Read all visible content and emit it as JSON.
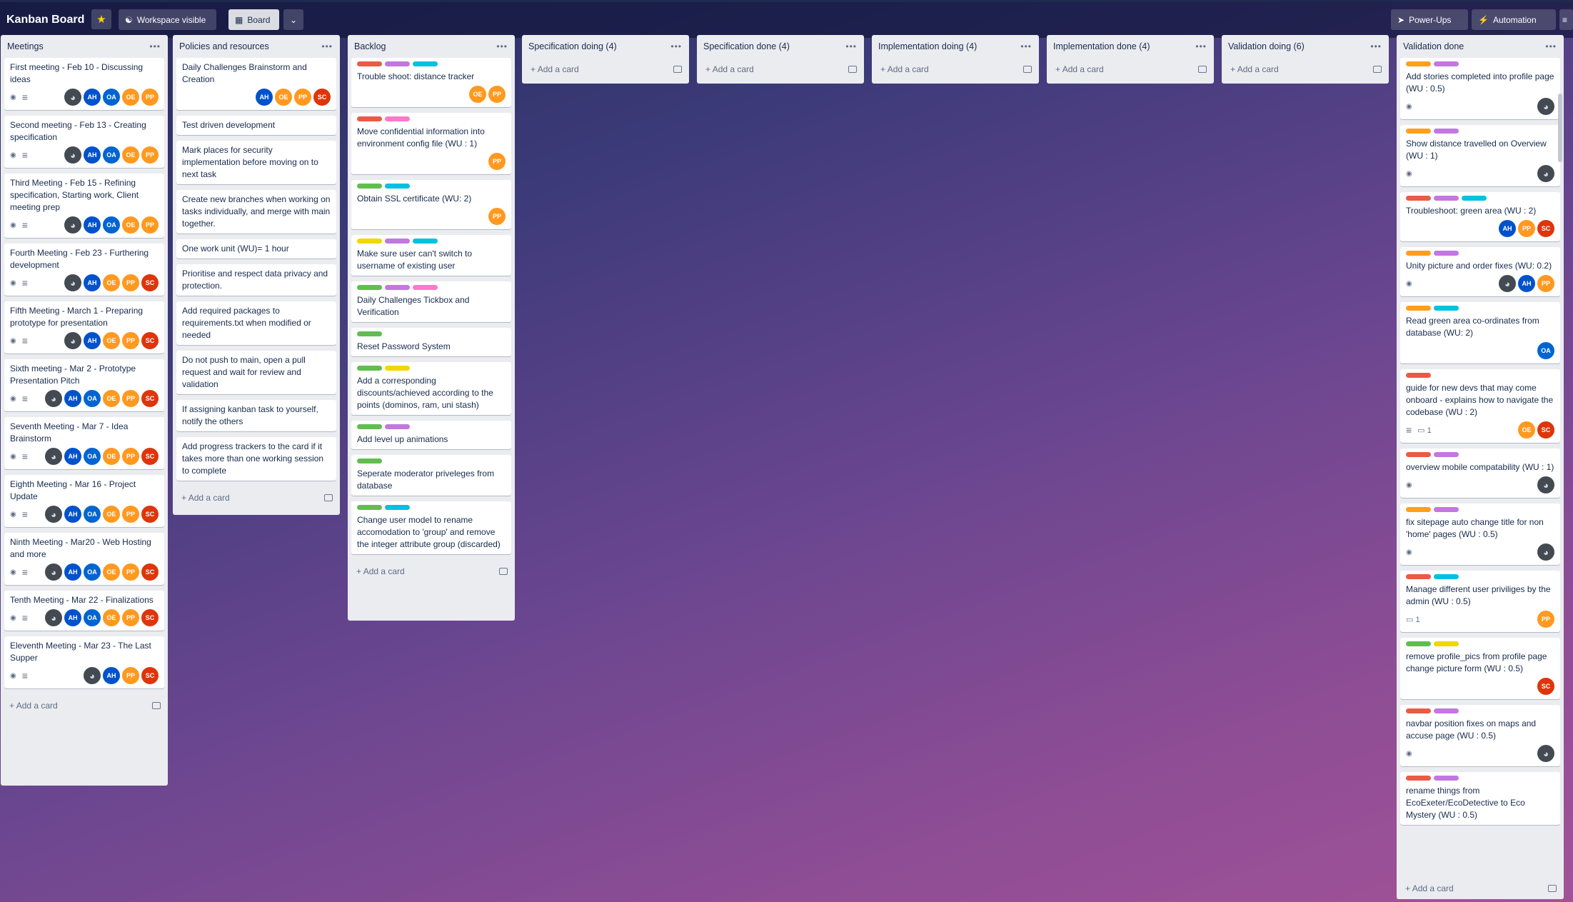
{
  "topbar": {
    "title": "Kanban Board",
    "visibility": "Workspace visible",
    "view": "Board",
    "powerups": "Power-Ups",
    "automation": "Automation"
  },
  "add_card": "Add a card",
  "lists": [
    {
      "title": "Meetings",
      "cards": [
        {
          "title": "First meeting - Feb 10 - Discussing ideas",
          "badges": [
            "eye",
            "desc"
          ],
          "members": [
            "img",
            "AH",
            "OA",
            "OE",
            "PP"
          ]
        },
        {
          "title": "Second meeting - Feb 13 - Creating specification",
          "badges": [
            "eye",
            "desc"
          ],
          "members": [
            "img",
            "AH",
            "OA",
            "OE",
            "PP"
          ]
        },
        {
          "title": "Third Meeting - Feb 15 - Refining specification, Starting work, Client meeting prep",
          "badges": [
            "eye",
            "desc"
          ],
          "members": [
            "img",
            "AH",
            "OA",
            "OE",
            "PP"
          ]
        },
        {
          "title": "Fourth Meeting - Feb 23 - Furthering development",
          "badges": [
            "eye",
            "desc"
          ],
          "members": [
            "img",
            "AH",
            "OE",
            "PP",
            "SC"
          ]
        },
        {
          "title": "Fifth Meeting - March 1 - Preparing prototype for presentation",
          "badges": [
            "eye",
            "desc"
          ],
          "members": [
            "img",
            "AH",
            "OE",
            "PP",
            "SC"
          ]
        },
        {
          "title": "Sixth meeting - Mar 2 - Prototype Presentation Pitch",
          "badges": [
            "eye",
            "desc"
          ],
          "members": [
            "img",
            "AH",
            "OA",
            "OE",
            "PP",
            "SC"
          ]
        },
        {
          "title": "Seventh Meeting - Mar 7 - Idea Brainstorm",
          "badges": [
            "eye",
            "desc"
          ],
          "members": [
            "img",
            "AH",
            "OA",
            "OE",
            "PP",
            "SC"
          ]
        },
        {
          "title": "Eighth Meeting - Mar 16 - Project Update",
          "badges": [
            "eye",
            "desc"
          ],
          "members": [
            "img",
            "AH",
            "OA",
            "OE",
            "PP",
            "SC"
          ]
        },
        {
          "title": "Ninth Meeting - Mar20 - Web Hosting and more",
          "badges": [
            "eye",
            "desc"
          ],
          "members": [
            "img",
            "AH",
            "OA",
            "OE",
            "PP",
            "SC"
          ]
        },
        {
          "title": "Tenth Meeting - Mar 22 - Finalizations",
          "badges": [
            "eye",
            "desc"
          ],
          "members": [
            "img",
            "AH",
            "OA",
            "OE",
            "PP",
            "SC"
          ]
        },
        {
          "title": "Eleventh Meeting - Mar 23 - The Last Supper",
          "badges": [
            "eye",
            "desc"
          ],
          "members": [
            "img",
            "AH",
            "PP",
            "SC"
          ]
        }
      ]
    },
    {
      "title": "Policies and resources",
      "cards": [
        {
          "title": "Daily Challenges Brainstorm and Creation",
          "members": [
            "AH",
            "OE",
            "PP",
            "SC"
          ]
        },
        {
          "title": "Test driven development"
        },
        {
          "title": "Mark places for security implementation before moving on to next task"
        },
        {
          "title": "Create new branches when working on tasks individually, and merge with main together."
        },
        {
          "title": "One work unit (WU)= 1 hour"
        },
        {
          "title": "Prioritise and respect data privacy and protection."
        },
        {
          "title": "Add required packages to requirements.txt when modified or needed"
        },
        {
          "title": "Do not push to main, open a pull request and wait for review and validation"
        },
        {
          "title": "If assigning kanban task to yourself, notify the others"
        },
        {
          "title": "Add progress trackers to the card if it takes more than one working session to complete"
        }
      ]
    },
    {
      "title": "Backlog",
      "cards": [
        {
          "labels": [
            "red",
            "purple",
            "blue"
          ],
          "title": "Trouble shoot: distance tracker",
          "members": [
            "OE",
            "PP"
          ]
        },
        {
          "labels": [
            "red",
            "pink"
          ],
          "title": "Move confidential information into environment config file (WU : 1)",
          "members": [
            "PP"
          ]
        },
        {
          "labels": [
            "green",
            "blue"
          ],
          "title": "Obtain SSL certificate (WU: 2)",
          "members": [
            "PP"
          ]
        },
        {
          "labels": [
            "yellow",
            "purple",
            "blue"
          ],
          "title": "Make sure user can't switch to username of existing user"
        },
        {
          "labels": [
            "green",
            "purple",
            "pink"
          ],
          "title": "Daily Challenges Tickbox and Verification"
        },
        {
          "labels": [
            "green"
          ],
          "title": "Reset Password System"
        },
        {
          "labels": [
            "green",
            "yellow"
          ],
          "title": "Add a corresponding discounts/achieved according to the points (dominos, ram, uni stash)"
        },
        {
          "labels": [
            "green",
            "purple"
          ],
          "title": "Add level up animations"
        },
        {
          "labels": [
            "green"
          ],
          "title": "Seperate moderator priveleges from database"
        },
        {
          "labels": [
            "green",
            "blue"
          ],
          "title": "Change user model to rename accomodation to 'group' and remove the integer attribute group (discarded)"
        }
      ]
    },
    {
      "title": "Specification doing (4)",
      "cards": []
    },
    {
      "title": "Specification done (4)",
      "cards": []
    },
    {
      "title": "Implementation doing (4)",
      "cards": []
    },
    {
      "title": "Implementation done (4)",
      "cards": []
    },
    {
      "title": "Validation doing (6)",
      "cards": []
    },
    {
      "title": "Validation done",
      "cards": [
        {
          "labels": [
            "orange",
            "purple"
          ],
          "title": "Add stories completed into profile page (WU : 0.5)",
          "badges": [
            "eye"
          ],
          "members": [
            "img"
          ]
        },
        {
          "labels": [
            "orange",
            "purple"
          ],
          "title": "Show distance travelled on Overview (WU : 1)",
          "badges": [
            "eye"
          ],
          "members": [
            "img"
          ]
        },
        {
          "labels": [
            "red",
            "purple",
            "blue"
          ],
          "title": "Troubleshoot: green area (WU : 2)",
          "members": [
            "AH",
            "PP",
            "SC"
          ]
        },
        {
          "labels": [
            "orange",
            "purple"
          ],
          "title": "Unity picture and order fixes (WU: 0.2)",
          "badges": [
            "eye"
          ],
          "members": [
            "img",
            "AH",
            "PP"
          ]
        },
        {
          "labels": [
            "orange",
            "blue"
          ],
          "title": "Read green area co-ordinates from database (WU: 2)",
          "members": [
            "OA"
          ]
        },
        {
          "labels": [
            "red"
          ],
          "title": "guide for new devs that may come onboard - explains how to navigate the codebase (WU : 2)",
          "badges": [
            "desc",
            "comment"
          ],
          "comments": "1",
          "members": [
            "OE",
            "SC"
          ]
        },
        {
          "labels": [
            "red",
            "purple"
          ],
          "title": "overview mobile compatability (WU : 1)",
          "badges": [
            "eye"
          ],
          "members": [
            "img"
          ]
        },
        {
          "labels": [
            "orange",
            "purple"
          ],
          "title": "fix sitepage auto change title for non 'home' pages (WU : 0.5)",
          "badges": [
            "eye"
          ],
          "members": [
            "img"
          ]
        },
        {
          "labels": [
            "red",
            "blue"
          ],
          "title": "Manage different user priviliges by the admin (WU : 0.5)",
          "badges": [
            "comment"
          ],
          "comments": "1",
          "members": [
            "PP"
          ]
        },
        {
          "labels": [
            "green",
            "yellow"
          ],
          "title": "remove profile_pics from profile page change picture form (WU : 0.5)",
          "members": [
            "SC"
          ]
        },
        {
          "labels": [
            "red",
            "purple"
          ],
          "title": "navbar position fixes on maps and accuse page (WU : 0.5)",
          "badges": [
            "eye"
          ],
          "members": [
            "img"
          ]
        },
        {
          "labels": [
            "red",
            "purple"
          ],
          "title": "rename things from EcoExeter/EcoDetective to Eco Mystery (WU : 0.5)"
        }
      ]
    }
  ],
  "colors": {
    "red": "#eb5a46",
    "purple": "#c377e0",
    "blue": "#00c2e0",
    "green": "#61bd4f",
    "yellow": "#f2d600",
    "orange": "#ff9f1a",
    "pink": "#ff78cb",
    "AH": "#0052cc",
    "OA": "#0065d1",
    "OE": "#ff991f",
    "PP": "#ff991f",
    "SC": "#de350b",
    "img": "#444a52"
  }
}
